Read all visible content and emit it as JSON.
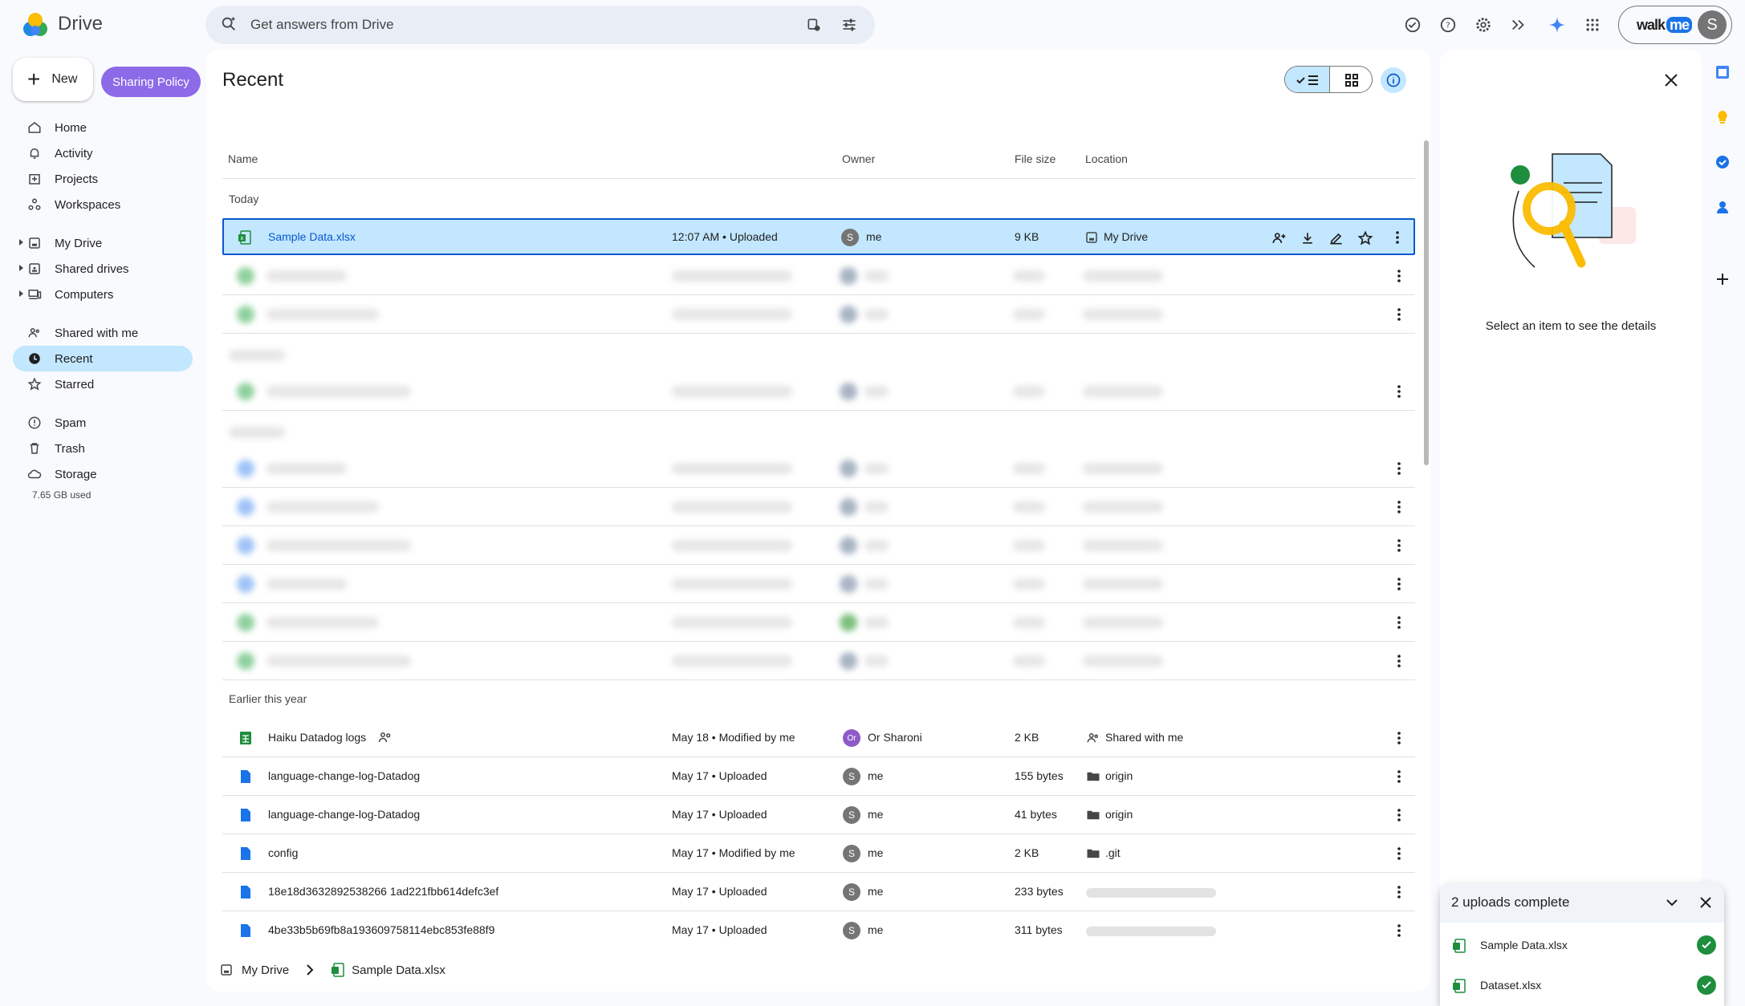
{
  "app": {
    "brand": "Drive"
  },
  "search": {
    "placeholder": "Get answers from Drive"
  },
  "account": {
    "walkme_text": "walk",
    "walkme_badge": "me",
    "avatar_letter": "S"
  },
  "nav": {
    "new_label": "New",
    "sharing_policy_label": "Sharing Policy",
    "items": [
      {
        "label": "Home"
      },
      {
        "label": "Activity"
      },
      {
        "label": "Projects"
      },
      {
        "label": "Workspaces"
      },
      {
        "label": "My Drive"
      },
      {
        "label": "Shared drives"
      },
      {
        "label": "Computers"
      },
      {
        "label": "Shared with me"
      },
      {
        "label": "Recent"
      },
      {
        "label": "Starred"
      },
      {
        "label": "Spam"
      },
      {
        "label": "Trash"
      },
      {
        "label": "Storage"
      }
    ],
    "storage_used": "7.65 GB used"
  },
  "main": {
    "title": "Recent",
    "columns": {
      "name": "Name",
      "owner": "Owner",
      "size": "File size",
      "location": "Location"
    },
    "groups": {
      "today": "Today",
      "earlier": "Earlier this year"
    },
    "selected_row": {
      "name": "Sample Data.xlsx",
      "activity": "12:07 AM • Uploaded",
      "owner_initial": "S",
      "owner": "me",
      "size": "9 KB",
      "location": "My Drive"
    },
    "rows": [
      {
        "name": "Haiku Datadog logs",
        "activity": "May 18 • Modified by me",
        "owner_initial": "Or",
        "owner": "Or Sharoni",
        "size": "2 KB",
        "location": "Shared with me"
      },
      {
        "name": "language-change-log-Datadog",
        "activity": "May 17 • Uploaded",
        "owner_initial": "S",
        "owner": "me",
        "size": "155 bytes",
        "location": "origin"
      },
      {
        "name": "language-change-log-Datadog",
        "activity": "May 17 • Uploaded",
        "owner_initial": "S",
        "owner": "me",
        "size": "41 bytes",
        "location": "origin"
      },
      {
        "name": "config",
        "activity": "May 17 • Modified by me",
        "owner_initial": "S",
        "owner": "me",
        "size": "2 KB",
        "location": ".git"
      },
      {
        "name": "18e18d3632892538266 1ad221fbb614defc3ef",
        "activity": "May 17 • Uploaded",
        "owner_initial": "S",
        "owner": "me",
        "size": "233 bytes",
        "location": ""
      },
      {
        "name": "4be33b5b69fb8a193609758114ebc853fe88f9",
        "activity": "May 17 • Uploaded",
        "owner_initial": "S",
        "owner": "me",
        "size": "311 bytes",
        "location": ""
      }
    ],
    "breadcrumb": {
      "root": "My Drive",
      "file": "Sample Data.xlsx"
    }
  },
  "details": {
    "message": "Select an item to see the details"
  },
  "uploads": {
    "title": "2 uploads complete",
    "files": [
      {
        "name": "Sample Data.xlsx"
      },
      {
        "name": "Dataset.xlsx"
      }
    ]
  },
  "colors": {
    "accent": "#0b57d0",
    "selected": "#c2e7ff",
    "sharing_policy": "#8c6ae8",
    "sheets_green": "#1e8e3e",
    "docs_blue": "#1a73e8"
  }
}
